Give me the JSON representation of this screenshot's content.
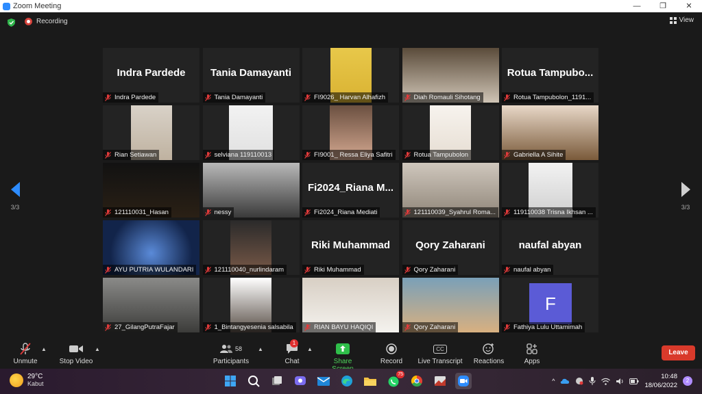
{
  "window": {
    "title": "Zoom Meeting",
    "minimize": "—",
    "restore": "❐",
    "close": "✕"
  },
  "topbar": {
    "recording_label": "Recording",
    "view_label": "View"
  },
  "pagination": {
    "left": "3/3",
    "right": "3/3"
  },
  "participants": [
    {
      "name": "Indra Pardede",
      "display": "Indra Pardede",
      "video": false
    },
    {
      "name": "Tania Damayanti",
      "display": "Tania Damayanti",
      "video": false
    },
    {
      "name": "FI9026_ Harvan Alhafizh",
      "display": "",
      "video": true
    },
    {
      "name": "Diah Romauli Sihotang",
      "display": "",
      "video": true
    },
    {
      "name": "Rotua Tampubolon_1191...",
      "display": "Rotua  Tampubo...",
      "video": false
    },
    {
      "name": "Rian Setiawan",
      "display": "",
      "video": true
    },
    {
      "name": "selviana 119110013",
      "display": "",
      "video": true
    },
    {
      "name": "FI9001_ Ressa Eliya Safitri",
      "display": "",
      "video": true
    },
    {
      "name": "Rotua Tampubolon",
      "display": "",
      "video": true
    },
    {
      "name": "Gabriella A Sihite",
      "display": "",
      "video": true
    },
    {
      "name": "121110031_Hasan",
      "display": "",
      "video": true
    },
    {
      "name": "nessy",
      "display": "",
      "video": true
    },
    {
      "name": "Fi2024_Riana Mediati",
      "display": "Fi2024_Riana  M...",
      "video": false
    },
    {
      "name": "121110039_Syahrul Roma...",
      "display": "",
      "video": true
    },
    {
      "name": "119110038 Trisna Ikhsan ...",
      "display": "",
      "video": true
    },
    {
      "name": "AYU PUTRIA WULANDARI",
      "display": "",
      "video": true
    },
    {
      "name": "121110040_nurlindaram",
      "display": "",
      "video": true
    },
    {
      "name": "Riki Muhammad",
      "display": "Riki Muhammad",
      "video": false
    },
    {
      "name": "Qory Zaharani",
      "display": "Qory Zaharani",
      "video": false
    },
    {
      "name": "naufal abyan",
      "display": "naufal abyan",
      "video": false
    },
    {
      "name": "27_GilangPutraFajar",
      "display": "",
      "video": true
    },
    {
      "name": "1_Bintangyesenia salsabila",
      "display": "",
      "video": true
    },
    {
      "name": "RIAN BAYU HAQIQI",
      "display": "",
      "video": true
    },
    {
      "name": "Qory Zaharani",
      "display": "",
      "video": true
    },
    {
      "name": "Fathiya Lulu Uttamimah",
      "display": "F",
      "video": false
    }
  ],
  "toolbar": {
    "unmute": "Unmute",
    "stop_video": "Stop Video",
    "participants": "Participants",
    "participants_count": "58",
    "chat": "Chat",
    "chat_badge": "1",
    "share_screen": "Share Screen",
    "record": "Record",
    "live_transcript": "Live Transcript",
    "cc": "CC",
    "reactions": "Reactions",
    "apps": "Apps",
    "leave": "Leave"
  },
  "taskbar": {
    "temperature": "29°C",
    "weather": "Kabut",
    "whatsapp_badge": "75",
    "time": "10:48",
    "date": "18/06/2022",
    "notifications": "2"
  },
  "colors": {
    "accent": "#2d8cff",
    "share": "#4fd45b",
    "leave": "#d93a2b",
    "active_speaker": "#c6e34b",
    "avatar_bg": "#5b5bd6"
  }
}
